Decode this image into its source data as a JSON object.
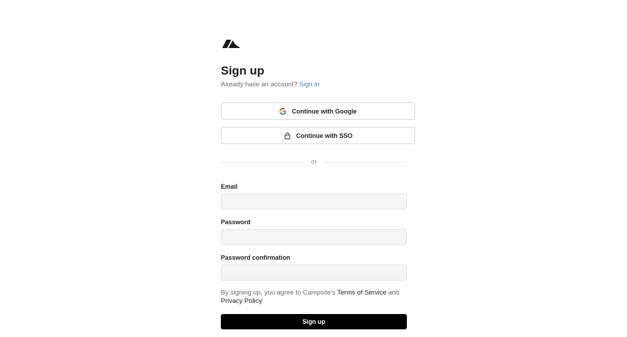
{
  "brand": {
    "logo_icon": "campsite-logo-icon",
    "color": "#1a1a1a"
  },
  "heading": {
    "title": "Sign up",
    "subtitle_prefix": "Already have an account?",
    "sign_in_link": "Sign in",
    "link_color": "#3b82c4"
  },
  "oauth": {
    "google": {
      "label": "Continue with Google",
      "icon": "google-icon"
    },
    "sso": {
      "label": "Continue with SSO",
      "icon": "lock-icon"
    }
  },
  "divider": {
    "text": "or"
  },
  "form": {
    "email": {
      "label": "Email",
      "value": "",
      "placeholder": ""
    },
    "password": {
      "label": "Password",
      "value": "",
      "placeholder": ""
    },
    "password_confirmation": {
      "label": "Password confirmation",
      "value": "",
      "placeholder": ""
    }
  },
  "terms": {
    "prefix": "By signing up, you agree to Campsite's",
    "terms_link": "Terms of Service",
    "conjunction": "and",
    "privacy_link": "Privacy Policy"
  },
  "submit": {
    "label": "Sign up",
    "background": "#000000",
    "color": "#ffffff"
  }
}
